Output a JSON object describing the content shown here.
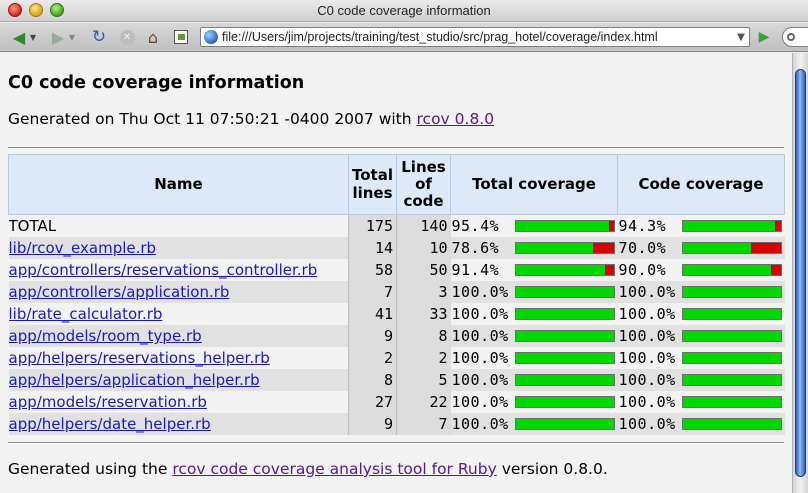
{
  "window": {
    "title": "C0 code coverage information"
  },
  "toolbar": {
    "url": "file:///Users/jim/projects/training/test_studio/src/prag_hotel/coverage/index.html"
  },
  "page": {
    "heading": "C0 code coverage information",
    "generated_prefix": "Generated on Thu Oct 11 07:50:21 -0400 2007 with ",
    "generated_link": "rcov 0.8.0",
    "footer_prefix": "Generated using the ",
    "footer_link": "rcov code coverage analysis tool for Ruby",
    "footer_suffix": " version 0.8.0."
  },
  "table": {
    "headers": {
      "name": "Name",
      "total_lines": "Total lines",
      "lines_of_code": "Lines of code",
      "total_coverage": "Total coverage",
      "code_coverage": "Code coverage"
    },
    "rows": [
      {
        "name": "TOTAL",
        "is_link": false,
        "total_lines": "175",
        "code_lines": "140",
        "total_cov": "95.4%",
        "total_frac": 0.954,
        "code_cov": "94.3%",
        "code_frac": 0.943
      },
      {
        "name": "lib/rcov_example.rb",
        "is_link": true,
        "total_lines": "14",
        "code_lines": "10",
        "total_cov": "78.6%",
        "total_frac": 0.786,
        "code_cov": "70.0%",
        "code_frac": 0.7
      },
      {
        "name": "app/controllers/reservations_controller.rb",
        "is_link": true,
        "total_lines": "58",
        "code_lines": "50",
        "total_cov": "91.4%",
        "total_frac": 0.914,
        "code_cov": "90.0%",
        "code_frac": 0.9
      },
      {
        "name": "app/controllers/application.rb",
        "is_link": true,
        "total_lines": "7",
        "code_lines": "3",
        "total_cov": "100.0%",
        "total_frac": 1.0,
        "code_cov": "100.0%",
        "code_frac": 1.0
      },
      {
        "name": "lib/rate_calculator.rb",
        "is_link": true,
        "total_lines": "41",
        "code_lines": "33",
        "total_cov": "100.0%",
        "total_frac": 1.0,
        "code_cov": "100.0%",
        "code_frac": 1.0
      },
      {
        "name": "app/models/room_type.rb",
        "is_link": true,
        "total_lines": "9",
        "code_lines": "8",
        "total_cov": "100.0%",
        "total_frac": 1.0,
        "code_cov": "100.0%",
        "code_frac": 1.0
      },
      {
        "name": "app/helpers/reservations_helper.rb",
        "is_link": true,
        "total_lines": "2",
        "code_lines": "2",
        "total_cov": "100.0%",
        "total_frac": 1.0,
        "code_cov": "100.0%",
        "code_frac": 1.0
      },
      {
        "name": "app/helpers/application_helper.rb",
        "is_link": true,
        "total_lines": "8",
        "code_lines": "5",
        "total_cov": "100.0%",
        "total_frac": 1.0,
        "code_cov": "100.0%",
        "code_frac": 1.0
      },
      {
        "name": "app/models/reservation.rb",
        "is_link": true,
        "total_lines": "27",
        "code_lines": "22",
        "total_cov": "100.0%",
        "total_frac": 1.0,
        "code_cov": "100.0%",
        "code_frac": 1.0
      },
      {
        "name": "app/helpers/date_helper.rb",
        "is_link": true,
        "total_lines": "9",
        "code_lines": "7",
        "total_cov": "100.0%",
        "total_frac": 1.0,
        "code_cov": "100.0%",
        "code_frac": 1.0
      }
    ]
  },
  "colors": {
    "covered": "#00d800",
    "uncovered": "#d80000",
    "header_bg": "#dde9f8",
    "visited_link": "#551a8b",
    "link": "#1a18c8"
  }
}
